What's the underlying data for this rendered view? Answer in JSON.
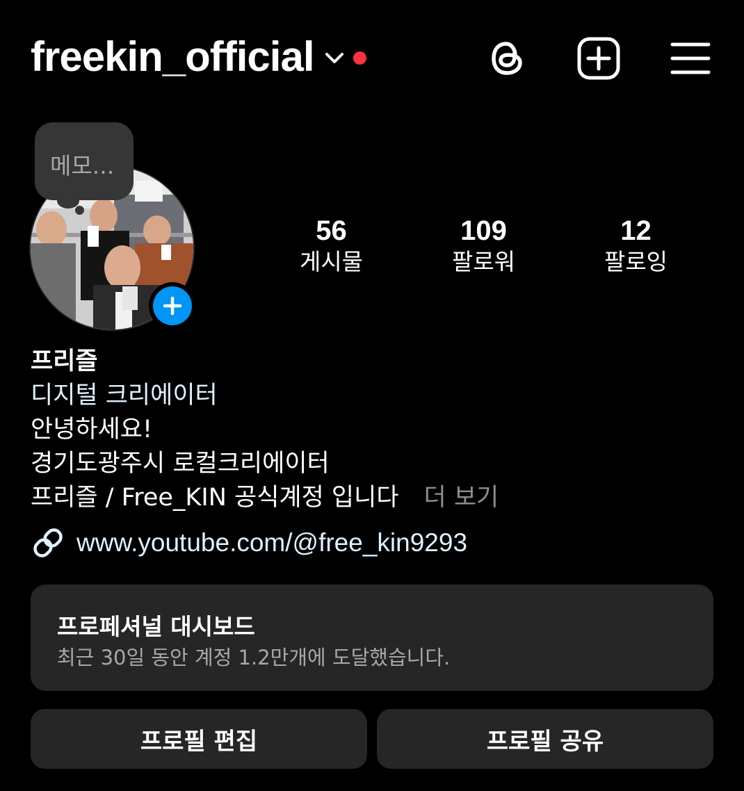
{
  "header": {
    "username": "freekin_official",
    "dropdown_icon": "chevron-down-icon",
    "notification_dot_color": "#ff3040",
    "icons": [
      "threads-icon",
      "create-post-icon",
      "hamburger-menu-icon"
    ]
  },
  "note": {
    "placeholder": "메모..."
  },
  "profile": {
    "avatar_icon": "profile-photo",
    "story_add_color": "#0095f6"
  },
  "stats": [
    {
      "value": "56",
      "label": "게시물"
    },
    {
      "value": "109",
      "label": "팔로워"
    },
    {
      "value": "12",
      "label": "팔로잉"
    }
  ],
  "bio": {
    "display_name": "프리즐",
    "category": "디지털 크리에이터",
    "lines": [
      "안녕하세요!",
      "경기도광주시 로컬크리에이터",
      "프리즐 / Free_KIN 공식계정 입니다"
    ],
    "more_label": "더 보기",
    "link_icon": "link-icon",
    "link": "www.youtube.com/@free_kin9293"
  },
  "dashboard": {
    "title": "프로페셔널 대시보드",
    "subtitle": "최근 30일 동안 계정 1.2만개에 도달했습니다."
  },
  "actions": {
    "edit_label": "프로필 편집",
    "share_label": "프로필 공유"
  },
  "colors": {
    "background": "#000000",
    "card": "#262626",
    "accent_blue": "#0095f6",
    "link": "#e0f1ff",
    "muted": "#a8a8a8"
  }
}
